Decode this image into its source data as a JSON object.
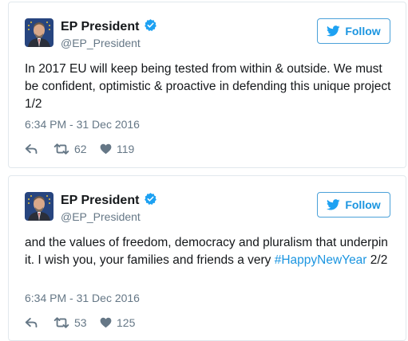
{
  "colors": {
    "accent": "#1b95e0",
    "text": "#14171a",
    "muted": "#657786",
    "border": "#e1e8ed"
  },
  "tweets": [
    {
      "display_name": "EP President",
      "handle": "@EP_President",
      "follow_label": "Follow",
      "text": "In 2017 EU will keep being tested from within & outside. We must be confident, optimistic & proactive in defending this unique project 1/2",
      "hashtag": "",
      "text_suffix": "",
      "timestamp": "6:34 PM - 31 Dec 2016",
      "retweets": "62",
      "likes": "119",
      "icons": {
        "reply": "reply-icon",
        "retweet": "retweet-icon",
        "like": "heart-icon",
        "verified": "verified-badge-icon",
        "follow": "twitter-bird-icon"
      }
    },
    {
      "display_name": "EP President",
      "handle": "@EP_President",
      "follow_label": "Follow",
      "text": "and the values of freedom, democracy and pluralism that underpin it. I wish you, your families and friends a very ",
      "hashtag": "#HappyNewYear",
      "text_suffix": " 2/2",
      "timestamp": "6:34 PM - 31 Dec 2016",
      "retweets": "53",
      "likes": "125",
      "icons": {
        "reply": "reply-icon",
        "retweet": "retweet-icon",
        "like": "heart-icon",
        "verified": "verified-badge-icon",
        "follow": "twitter-bird-icon"
      }
    }
  ]
}
